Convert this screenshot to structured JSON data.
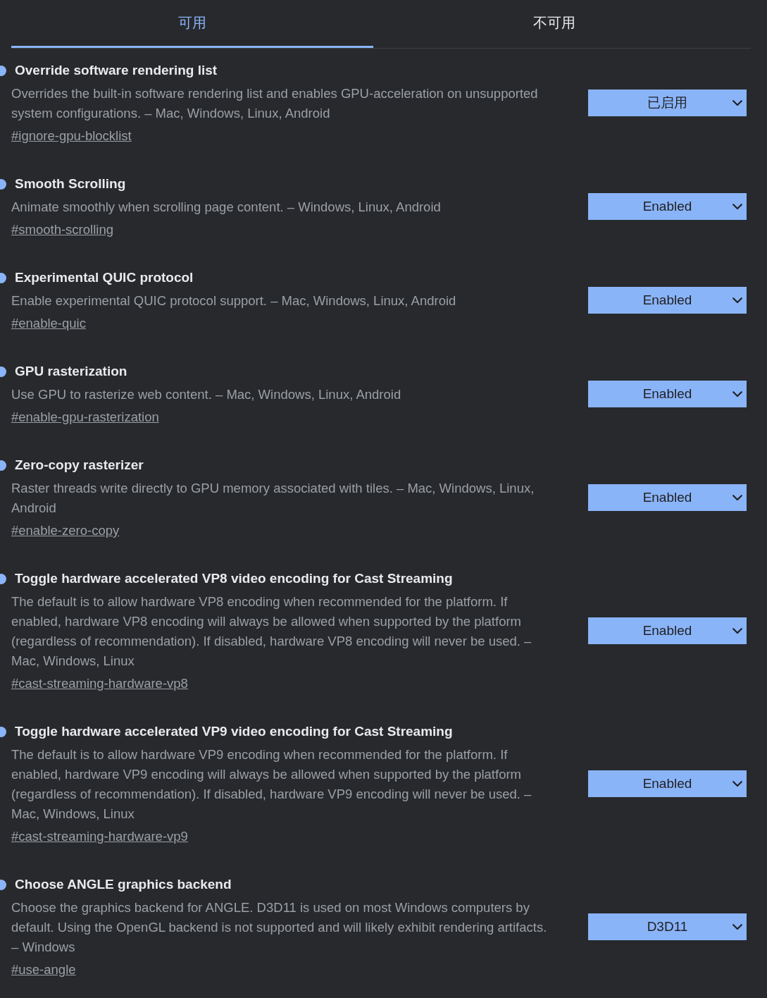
{
  "tabs": [
    {
      "label": "可用",
      "selected": true
    },
    {
      "label": "不可用",
      "selected": false
    }
  ],
  "experiments": [
    {
      "title": "Override software rendering list",
      "modified": true,
      "description": "Overrides the built-in software rendering list and enables GPU-acceleration on unsupported system configurations. – Mac, Windows, Linux, Android",
      "link": "#ignore-gpu-blocklist",
      "value": "已启用"
    },
    {
      "title": "Smooth Scrolling",
      "modified": true,
      "description": "Animate smoothly when scrolling page content. – Windows, Linux, Android",
      "link": "#smooth-scrolling",
      "value": "Enabled"
    },
    {
      "title": "Experimental QUIC protocol",
      "modified": true,
      "description": "Enable experimental QUIC protocol support. – Mac, Windows, Linux, Android",
      "link": "#enable-quic",
      "value": "Enabled"
    },
    {
      "title": "GPU rasterization",
      "modified": true,
      "description": "Use GPU to rasterize web content. – Mac, Windows, Linux, Android",
      "link": "#enable-gpu-rasterization",
      "value": "Enabled"
    },
    {
      "title": "Zero-copy rasterizer",
      "modified": true,
      "description": "Raster threads write directly to GPU memory associated with tiles. – Mac, Windows, Linux, Android",
      "link": "#enable-zero-copy",
      "value": "Enabled"
    },
    {
      "title": "Toggle hardware accelerated VP8 video encoding for Cast Streaming",
      "modified": true,
      "description": "The default is to allow hardware VP8 encoding when recommended for the platform. If enabled, hardware VP8 encoding will always be allowed when supported by the platform (regardless of recommendation). If disabled, hardware VP8 encoding will never be used. – Mac, Windows, Linux",
      "link": "#cast-streaming-hardware-vp8",
      "value": "Enabled"
    },
    {
      "title": "Toggle hardware accelerated VP9 video encoding for Cast Streaming",
      "modified": true,
      "description": "The default is to allow hardware VP9 encoding when recommended for the platform. If enabled, hardware VP9 encoding will always be allowed when supported by the platform (regardless of recommendation). If disabled, hardware VP9 encoding will never be used. – Mac, Windows, Linux",
      "link": "#cast-streaming-hardware-vp9",
      "value": "Enabled"
    },
    {
      "title": "Choose ANGLE graphics backend",
      "modified": true,
      "description": "Choose the graphics backend for ANGLE. D3D11 is used on most Windows computers by default. Using the OpenGL backend is not supported and will likely exhibit rendering artifacts. – Windows",
      "link": "#use-angle",
      "value": "D3D11"
    }
  ]
}
